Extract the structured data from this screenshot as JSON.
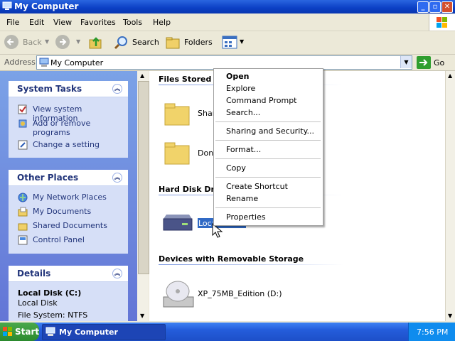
{
  "window": {
    "title": "My Computer"
  },
  "menubar": {
    "items": [
      "File",
      "Edit",
      "View",
      "Favorites",
      "Tools",
      "Help"
    ]
  },
  "toolbar": {
    "back": "Back",
    "search": "Search",
    "folders": "Folders"
  },
  "address": {
    "label": "Address",
    "value": "My Computer",
    "go": "Go"
  },
  "left_pane": {
    "system_tasks": {
      "title": "System Tasks",
      "items": [
        "View system information",
        "Add or remove",
        "programs",
        "Change a setting"
      ]
    },
    "other_places": {
      "title": "Other Places",
      "items": [
        "My Network Places",
        "My Documents",
        "Shared Documents",
        "Control Panel"
      ]
    },
    "details": {
      "title": "Details",
      "name": "Local Disk (C:)",
      "type": "Local Disk",
      "fs": "File System: NTFS"
    }
  },
  "main": {
    "group_files": "Files Stored o",
    "file_items": [
      "Shar",
      "Doni"
    ],
    "group_hdd": "Hard Disk Driv",
    "hdd_item": "Local",
    "group_removable": "Devices with Removable Storage",
    "cd_item": "XP_75MB_Edition (D:)"
  },
  "context_menu": {
    "items": [
      "Open",
      "Explore",
      "Command Prompt",
      "Search...",
      "Sharing and Security...",
      "Format...",
      "Copy",
      "Create Shortcut",
      "Rename",
      "Properties"
    ]
  },
  "taskbar": {
    "start": "Start",
    "task": "My Computer",
    "clock": "7:56 PM"
  },
  "colors": {
    "titlebar": "#0b3fc4",
    "taskbar": "#245ddb",
    "start": "#2b8a2e",
    "leftpane": "#6f8ee0"
  }
}
